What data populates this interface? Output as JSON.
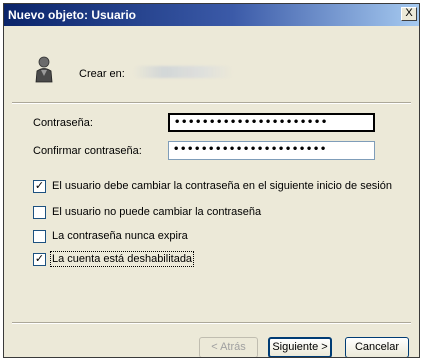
{
  "window": {
    "title": "Nuevo objeto: Usuario",
    "close_glyph": "X"
  },
  "header": {
    "create_in_label": "Crear en:",
    "icon": "user-icon"
  },
  "form": {
    "password_label": "Contraseña:",
    "password_value": "••••••••••••••••••••••",
    "confirm_label": "Confirmar contraseña:",
    "confirm_value": "••••••••••••••••••••••"
  },
  "options": [
    {
      "label": "El usuario debe cambiar la contraseña en el siguiente inicio de sesión",
      "checked": true
    },
    {
      "label": "El usuario no puede cambiar la contraseña",
      "checked": false
    },
    {
      "label": "La contraseña nunca expira",
      "checked": false
    },
    {
      "label": "La cuenta está deshabilitada",
      "checked": true
    }
  ],
  "check_glyph": "✓",
  "buttons": {
    "back": "< Atrás",
    "next": "Siguiente >",
    "cancel": "Cancelar"
  }
}
